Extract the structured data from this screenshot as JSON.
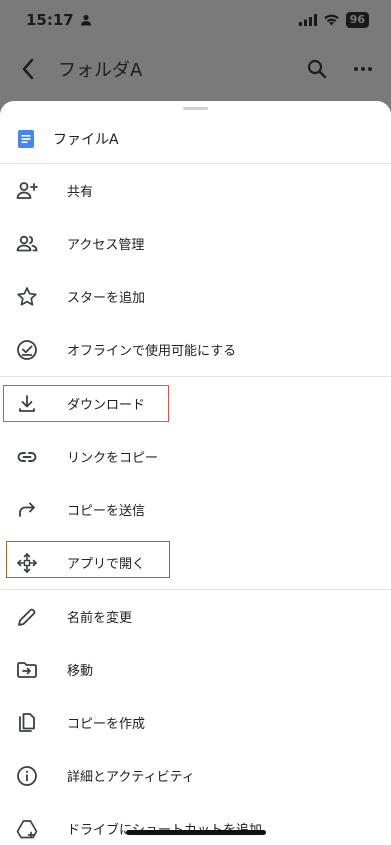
{
  "status_bar": {
    "time": "15:17",
    "battery": "96"
  },
  "app_bar": {
    "title": "フォルダA"
  },
  "sheet": {
    "file_name": "ファイルA",
    "file_icon": "docs-icon"
  },
  "menu": {
    "share": "共有",
    "manage_access": "アクセス管理",
    "add_star": "スターを追加",
    "offline": "オフラインで使用可能にする",
    "download": "ダウンロード",
    "copy_link": "リンクをコピー",
    "send_copy": "コピーを送信",
    "open_with": "アプリで開く",
    "rename": "名前を変更",
    "move": "移動",
    "make_copy": "コピーを作成",
    "details": "詳細とアクティビティ",
    "add_shortcut": "ドライブにショートカットを追加"
  },
  "colors": {
    "accent_blue": "#4285f4",
    "highlight_red": "#d9534f",
    "highlight_brown": "#9a6d2d"
  }
}
